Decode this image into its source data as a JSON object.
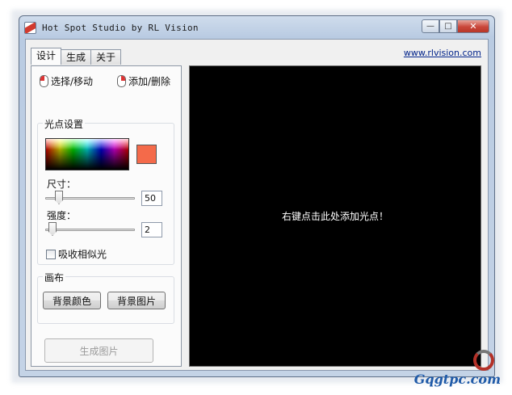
{
  "window": {
    "title": "Hot Spot Studio by RL Vision",
    "minimize_glyph": "—",
    "maximize_glyph": "□",
    "close_glyph": "✕"
  },
  "tabs": [
    {
      "label": "设计",
      "active": true
    },
    {
      "label": "生成",
      "active": false
    },
    {
      "label": "关于",
      "active": false
    }
  ],
  "website_link": "www.rlvision.com",
  "tools": {
    "select_move": "选择/移动",
    "add_delete": "添加/删除"
  },
  "hotspot_settings": {
    "group_label": "光点设置",
    "color_hex": "#f46a4a",
    "size_label": "尺寸：",
    "size_value": "50",
    "intensity_label": "强度：",
    "intensity_value": "2",
    "absorb_label": "吸收相似光",
    "absorb_checked": false
  },
  "canvas_group": {
    "group_label": "画布",
    "bg_color_button": "背景颜色",
    "bg_image_button": "背景图片"
  },
  "generate_button": "生成图片",
  "canvas": {
    "hint": "右键点击此处添加光点！",
    "background": "#000000"
  },
  "watermark": {
    "text": "Gqgtpc.com"
  }
}
